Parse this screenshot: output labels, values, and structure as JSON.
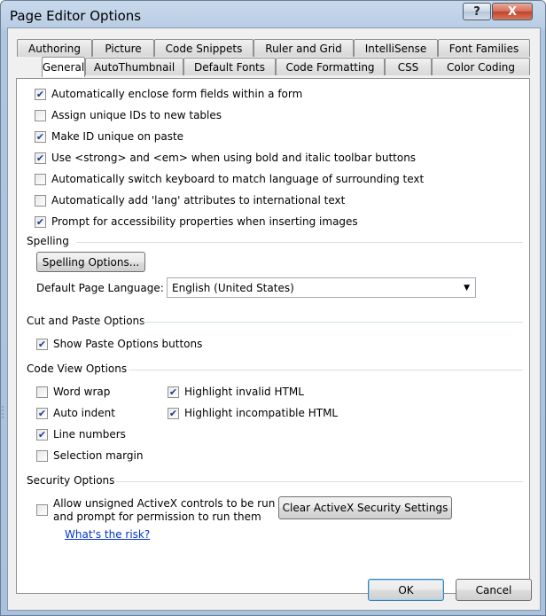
{
  "window": {
    "title": "Page Editor Options"
  },
  "title_buttons": {
    "help": "?",
    "close": "X"
  },
  "tabs_row1": [
    "Authoring",
    "Picture",
    "Code Snippets",
    "Ruler and Grid",
    "IntelliSense",
    "Font Families"
  ],
  "tabs_row2": [
    "General",
    "AutoThumbnail",
    "Default Fonts",
    "Code Formatting",
    "CSS",
    "Color Coding"
  ],
  "active_tab": "General",
  "general": [
    {
      "label": "Automatically enclose form fields within a form",
      "checked": true
    },
    {
      "label": "Assign unique IDs to new tables",
      "checked": false
    },
    {
      "label": "Make ID unique on paste",
      "checked": true
    },
    {
      "label": "Use <strong> and <em> when using bold and italic toolbar buttons",
      "checked": true
    },
    {
      "label": "Automatically switch keyboard to match language of surrounding text",
      "checked": false
    },
    {
      "label": "Automatically add 'lang' attributes to international text",
      "checked": false
    },
    {
      "label": "Prompt for accessibility properties when inserting images",
      "checked": true
    }
  ],
  "spelling": {
    "title": "Spelling",
    "button": "Spelling Options...",
    "language_label": "Default Page Language:",
    "language_value": "English (United States)"
  },
  "cut_paste": {
    "title": "Cut and Paste Options",
    "show_paste": {
      "label": "Show Paste Options buttons",
      "checked": true
    }
  },
  "code_view": {
    "title": "Code View Options",
    "left": [
      {
        "label": "Word wrap",
        "checked": false
      },
      {
        "label": "Auto indent",
        "checked": true
      },
      {
        "label": "Line numbers",
        "checked": true
      },
      {
        "label": "Selection margin",
        "checked": false
      }
    ],
    "right": [
      {
        "label": "Highlight invalid HTML",
        "checked": true
      },
      {
        "label": "Highlight incompatible HTML",
        "checked": true
      }
    ]
  },
  "security": {
    "title": "Security Options",
    "allow_line1": "Allow unsigned ActiveX controls to be run",
    "allow_line2": "and prompt for permission to run them",
    "allow_checked": false,
    "clear_button": "Clear ActiveX Security Settings",
    "risk_link": "What's the risk?"
  },
  "footer": {
    "ok": "OK",
    "cancel": "Cancel"
  },
  "check_glyph": "✔"
}
